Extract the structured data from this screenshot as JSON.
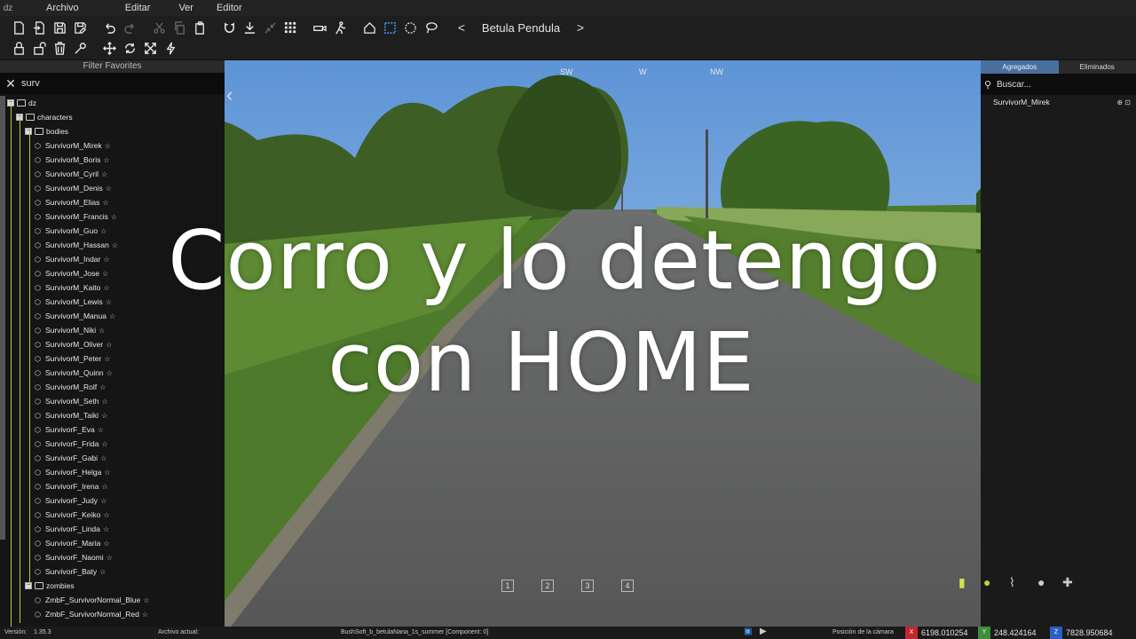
{
  "menu": {
    "logo": "dz",
    "items": [
      "Archivo",
      "Editar",
      "Ver",
      "Editor"
    ]
  },
  "toolbar": {
    "preset_prev": "<",
    "preset_name": "Betula Pendula",
    "preset_next": ">"
  },
  "left_panel": {
    "filter_tab": "Filter Favorites",
    "search_value": "surv",
    "tree": {
      "root": "dz",
      "folder_characters": "characters",
      "folder_bodies": "bodies",
      "bodies": [
        "SurvivorM_Mirek",
        "SurvivorM_Boris",
        "SurvivorM_Cyril",
        "SurvivorM_Denis",
        "SurvivorM_Elias",
        "SurvivorM_Francis",
        "SurvivorM_Guo",
        "SurvivorM_Hassan",
        "SurvivorM_Indar",
        "SurvivorM_Jose",
        "SurvivorM_Kaito",
        "SurvivorM_Lewis",
        "SurvivorM_Manua",
        "SurvivorM_Niki",
        "SurvivorM_Oliver",
        "SurvivorM_Peter",
        "SurvivorM_Quinn",
        "SurvivorM_Rolf",
        "SurvivorM_Seth",
        "SurvivorM_Taiki",
        "SurvivorF_Eva",
        "SurvivorF_Frida",
        "SurvivorF_Gabi",
        "SurvivorF_Helga",
        "SurvivorF_Irena",
        "SurvivorF_Judy",
        "SurvivorF_Keiko",
        "SurvivorF_Linda",
        "SurvivorF_Maria",
        "SurvivorF_Naomi",
        "SurvivorF_Baty"
      ],
      "folder_zombies": "zombies",
      "zombies": [
        "ZmbF_SurvivorNormal_Blue",
        "ZmbF_SurvivorNormal_Red"
      ]
    }
  },
  "viewport": {
    "compass": [
      "SW",
      "W",
      "NW"
    ],
    "layers": [
      "1",
      "2",
      "3",
      "4"
    ],
    "caption_line1": "Corro y lo detengo",
    "caption_line2": "con HOME"
  },
  "right_panel": {
    "tab_added": "Agregados",
    "tab_removed": "Eliminados",
    "search_placeholder": "Buscar...",
    "items": [
      "SurvivorM_Mirek"
    ]
  },
  "status": {
    "version_label": "Versión:",
    "version_value": "1.35.3",
    "file_label": "Archivo actual:",
    "component": "BushSoft_b_betulaNana_1s_summer [Component: 0]",
    "camera_label": "Posición de la cámara",
    "x_tag": "X",
    "x_value": "6198.010254",
    "y_tag": "Y",
    "y_value": "248.424164",
    "z_tag": "Z",
    "z_value": "7828.950684"
  },
  "colors": {
    "accent_blue": "#4a6f9c",
    "tree_guide": "#b2d235",
    "x_red": "#c0282d",
    "y_green": "#3f8f3a",
    "z_blue": "#2f5ec4"
  }
}
